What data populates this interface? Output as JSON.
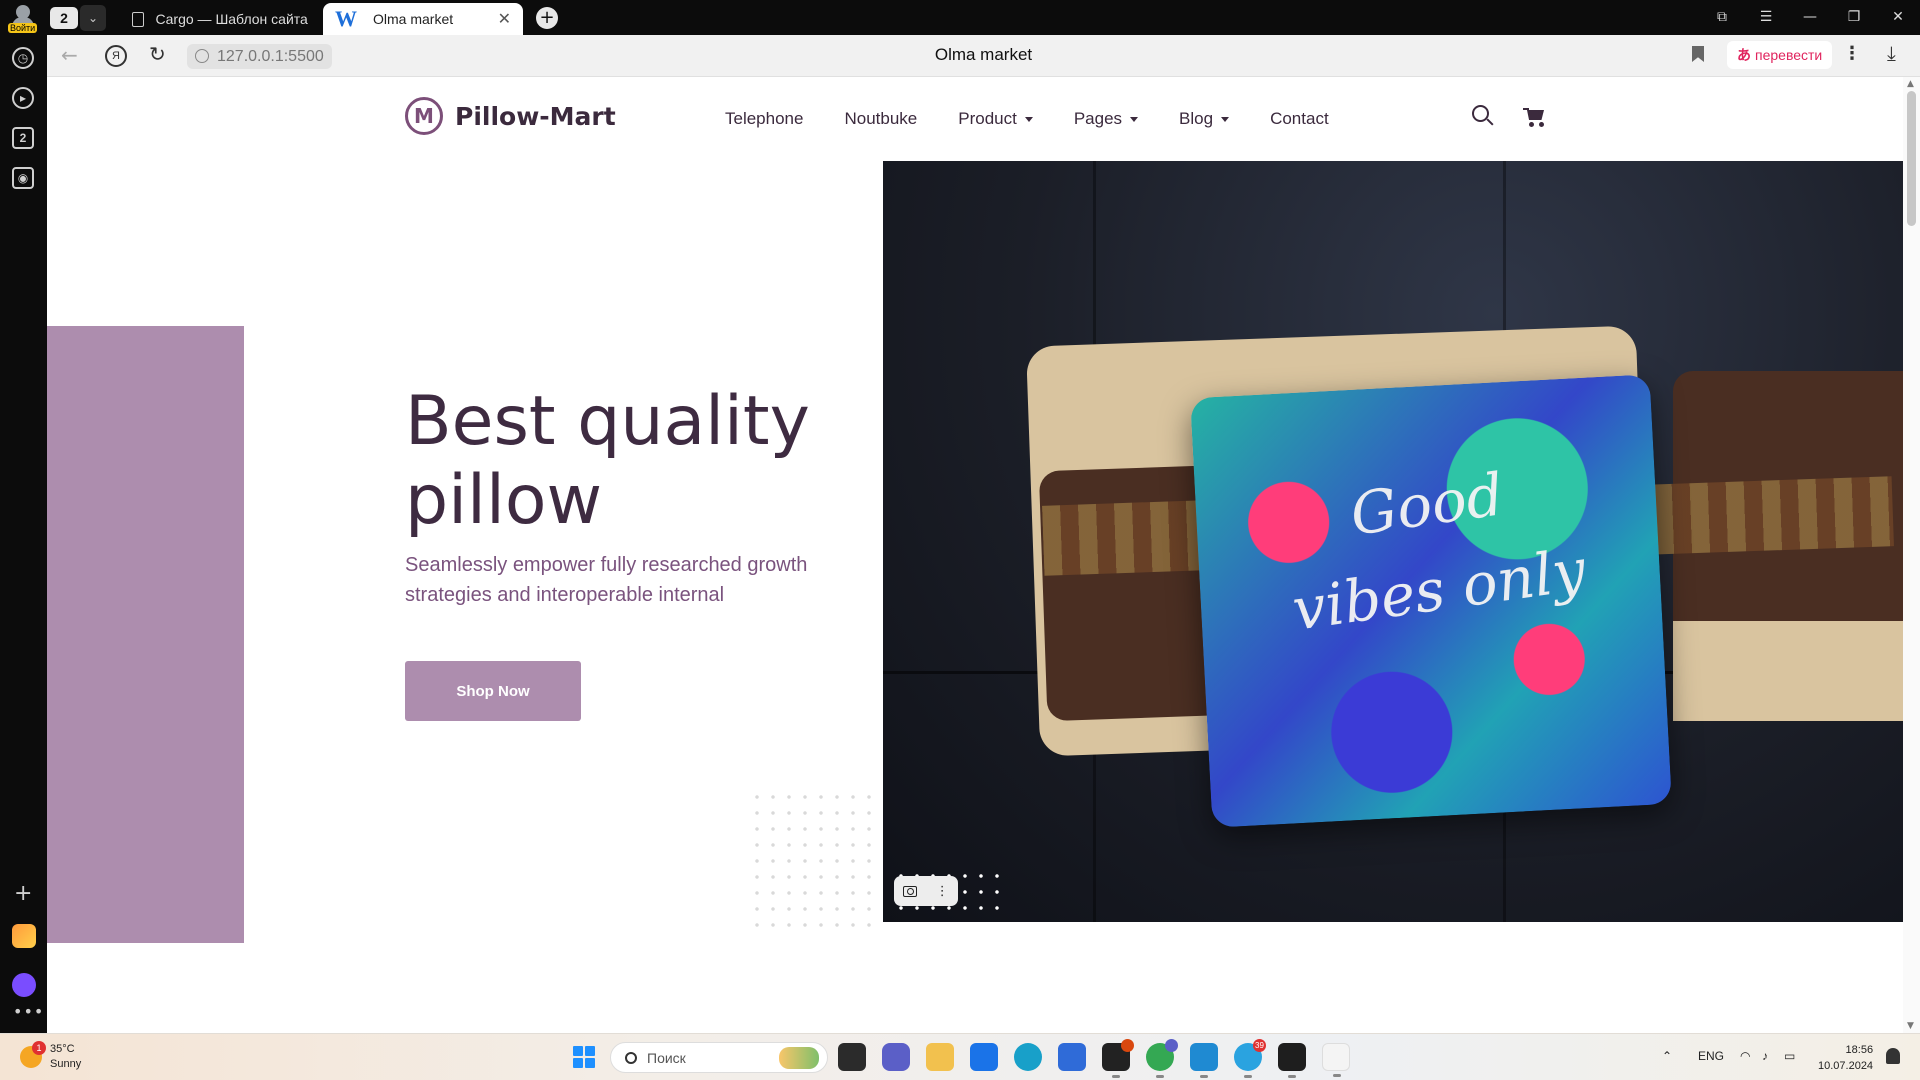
{
  "browser": {
    "tab_count": "2",
    "login_label": "Войти",
    "tabs": [
      {
        "title": "Cargo — Шаблон сайта от",
        "active": false
      },
      {
        "title": "Olma market",
        "active": true,
        "icon_letter": "W"
      }
    ],
    "address": {
      "url": "127.0.0.1:5500",
      "page_title": "Olma market",
      "translate_label": "перевести",
      "translate_icon": "あ"
    },
    "sidebar_items": [
      "history-icon",
      "play-icon",
      "tabs-icon",
      "screenshot-icon"
    ],
    "sidebar_tab_number": "2"
  },
  "site": {
    "brand": "Pillow-Mart",
    "brand_mark": "M",
    "nav": [
      {
        "label": "Telephone",
        "dropdown": false
      },
      {
        "label": "Noutbuke",
        "dropdown": false
      },
      {
        "label": "Product",
        "dropdown": true
      },
      {
        "label": "Pages",
        "dropdown": true
      },
      {
        "label": "Blog",
        "dropdown": true
      },
      {
        "label": "Contact",
        "dropdown": false
      }
    ],
    "hero": {
      "title": "Best quality pillow",
      "subtitle": "Seamlessly empower fully researched growth strategies and interoperable internal",
      "cta": "Shop Now",
      "image_text": "Good vibes only"
    },
    "colors": {
      "accent": "#ad8dae",
      "heading": "#3e2b41",
      "subtitle": "#7a537e"
    }
  },
  "taskbar": {
    "weather": {
      "temp": "35°C",
      "condition": "Sunny",
      "badge": "1"
    },
    "search_placeholder": "Поиск",
    "telegram_badge": "39",
    "lang": "ENG",
    "time": "18:56",
    "date": "10.07.2024"
  }
}
